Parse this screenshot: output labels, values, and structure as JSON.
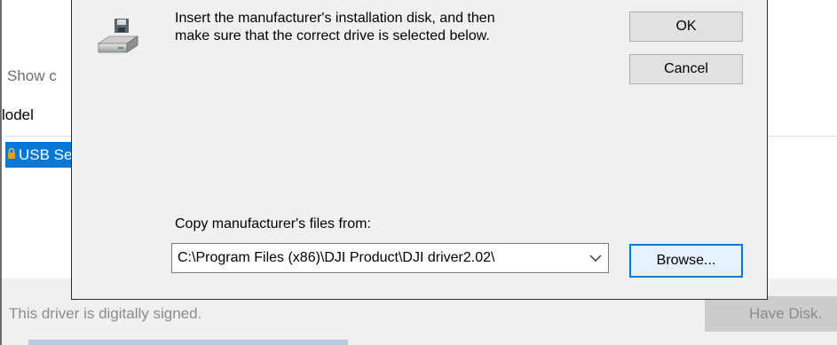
{
  "background": {
    "show_text": "Show c",
    "model_header": "lodel",
    "selected_row_label": "USB Se",
    "signed_text": "This driver is digitally signed.",
    "have_disk_label": "Have Disk."
  },
  "dialog": {
    "message": "Insert the manufacturer's installation disk, and then make sure that the correct drive is selected below.",
    "ok_label": "OK",
    "cancel_label": "Cancel",
    "copy_from_label": "Copy manufacturer's files from:",
    "path_value": "C:\\Program Files (x86)\\DJI Product\\DJI driver2.02\\",
    "browse_label": "Browse..."
  },
  "colors": {
    "accent": "#0078d7",
    "dialog_bg": "#f0f0f0",
    "button_bg": "#e1e1e1"
  }
}
